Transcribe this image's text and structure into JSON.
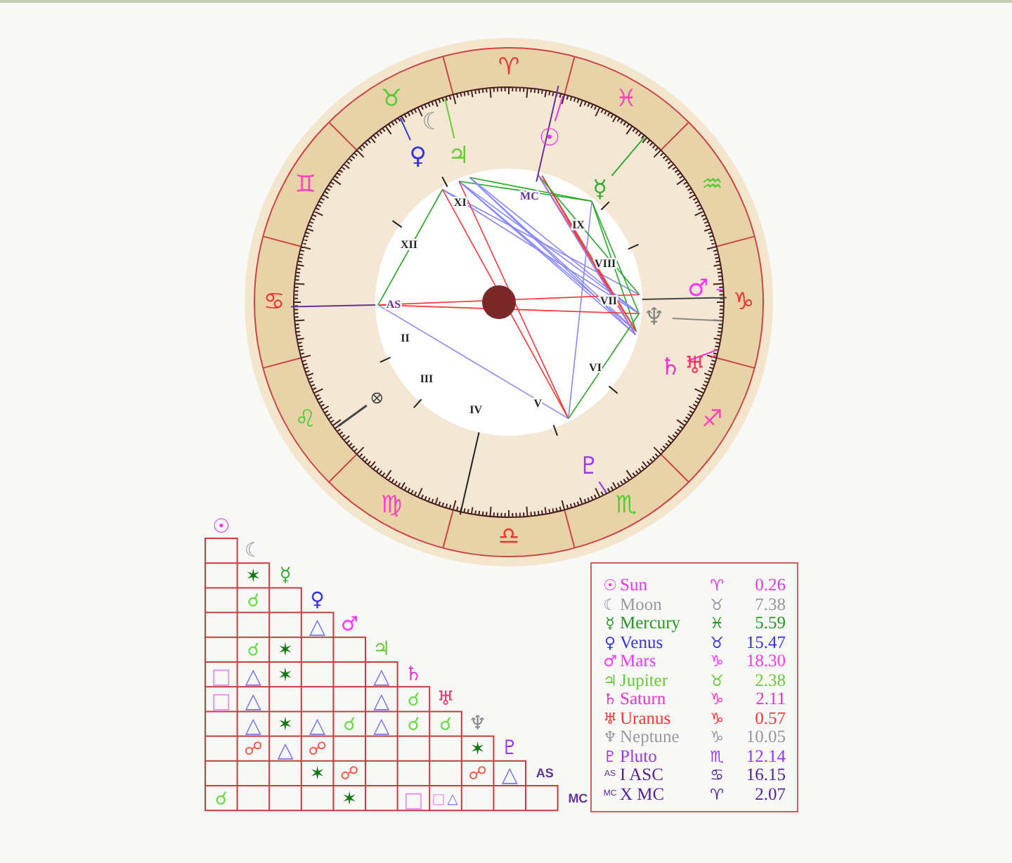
{
  "wheel": {
    "signs": [
      {
        "glyph": "♈︎",
        "color": "#ee3333"
      },
      {
        "glyph": "♉︎",
        "color": "#55cc33"
      },
      {
        "glyph": "♊︎",
        "color": "#ff44bb"
      },
      {
        "glyph": "♋︎",
        "color": "#ee3333"
      },
      {
        "glyph": "♌︎",
        "color": "#55cc33"
      },
      {
        "glyph": "♍︎",
        "color": "#ff44bb"
      },
      {
        "glyph": "♎︎",
        "color": "#ee3333"
      },
      {
        "glyph": "♏︎",
        "color": "#55cc33"
      },
      {
        "glyph": "♐︎",
        "color": "#ff44bb"
      },
      {
        "glyph": "♑︎",
        "color": "#ee3333"
      },
      {
        "glyph": "♒︎",
        "color": "#55cc33"
      },
      {
        "glyph": "♓︎",
        "color": "#ff44bb"
      }
    ],
    "planets": [
      {
        "glyph": "☉",
        "color": "#ee33ee"
      },
      {
        "glyph": "☾",
        "color": "#999999"
      },
      {
        "glyph": "☿",
        "color": "#33aa33"
      },
      {
        "glyph": "♀",
        "color": "#3333ee"
      },
      {
        "glyph": "♂",
        "color": "#ff33ff"
      },
      {
        "glyph": "♃",
        "color": "#66cc33"
      },
      {
        "glyph": "♄",
        "color": "#ee33cc"
      },
      {
        "glyph": "♅",
        "color": "#ff3366"
      },
      {
        "glyph": "♆",
        "color": "#888888"
      },
      {
        "glyph": "♇",
        "color": "#9933ff"
      }
    ],
    "houses": [
      {
        "label": "AS",
        "color": "#663399"
      },
      {
        "label": "II",
        "color": "#222222"
      },
      {
        "label": "III",
        "color": "#222222"
      },
      {
        "label": "IV",
        "color": "#222222"
      },
      {
        "label": "V",
        "color": "#222222"
      },
      {
        "label": "VI",
        "color": "#222222"
      },
      {
        "label": "VII",
        "color": "#222222"
      },
      {
        "label": "VIII",
        "color": "#222222"
      },
      {
        "label": "IX",
        "color": "#222222"
      },
      {
        "label": "MC",
        "color": "#663399"
      },
      {
        "label": "XI",
        "color": "#222222"
      },
      {
        "label": "XII",
        "color": "#222222"
      }
    ]
  },
  "aspect_grid": {
    "headers": [
      {
        "kind": "planet",
        "glyph": "☉",
        "color": "#ee33ee"
      },
      {
        "kind": "planet",
        "glyph": "☾",
        "color": "#999999"
      },
      {
        "kind": "planet",
        "glyph": "☿",
        "color": "#33aa33"
      },
      {
        "kind": "planet",
        "glyph": "♀",
        "color": "#3333ee"
      },
      {
        "kind": "planet",
        "glyph": "♂",
        "color": "#ff33ff"
      },
      {
        "kind": "planet",
        "glyph": "♃",
        "color": "#66cc33"
      },
      {
        "kind": "planet",
        "glyph": "♄",
        "color": "#ee33cc"
      },
      {
        "kind": "planet",
        "glyph": "♅",
        "color": "#ff3366"
      },
      {
        "kind": "planet",
        "glyph": "♆",
        "color": "#888888"
      },
      {
        "kind": "planet",
        "glyph": "♇",
        "color": "#9933ff"
      },
      {
        "kind": "angle",
        "glyph": "AS",
        "color": "#663399"
      },
      {
        "kind": "angle",
        "glyph": "MC",
        "color": "#663399"
      }
    ],
    "rows": [
      [
        null
      ],
      [
        null,
        [
          {
            "kind": "sextile",
            "symbol": "✶"
          }
        ]
      ],
      [
        null,
        [
          {
            "kind": "conjunction",
            "symbol": "☌"
          }
        ],
        null
      ],
      [
        null,
        null,
        null,
        [
          {
            "kind": "trine",
            "symbol": "△"
          }
        ]
      ],
      [
        null,
        [
          {
            "kind": "conjunction",
            "symbol": "☌"
          }
        ],
        [
          {
            "kind": "sextile",
            "symbol": "✶"
          }
        ],
        null,
        null
      ],
      [
        [
          {
            "kind": "square",
            "symbol": "□"
          }
        ],
        [
          {
            "kind": "trine",
            "symbol": "△"
          }
        ],
        [
          {
            "kind": "sextile",
            "symbol": "✶"
          }
        ],
        null,
        null,
        [
          {
            "kind": "trine",
            "symbol": "△"
          }
        ]
      ],
      [
        [
          {
            "kind": "square",
            "symbol": "□"
          }
        ],
        [
          {
            "kind": "trine",
            "symbol": "△"
          }
        ],
        null,
        null,
        null,
        [
          {
            "kind": "trine",
            "symbol": "△"
          }
        ],
        [
          {
            "kind": "conjunction",
            "symbol": "☌"
          }
        ]
      ],
      [
        null,
        [
          {
            "kind": "trine",
            "symbol": "△"
          }
        ],
        [
          {
            "kind": "sextile",
            "symbol": "✶"
          }
        ],
        [
          {
            "kind": "trine",
            "symbol": "△"
          }
        ],
        [
          {
            "kind": "conjunction",
            "symbol": "☌"
          }
        ],
        [
          {
            "kind": "trine",
            "symbol": "△"
          }
        ],
        [
          {
            "kind": "conjunction",
            "symbol": "☌"
          }
        ],
        [
          {
            "kind": "conjunction",
            "symbol": "☌"
          }
        ]
      ],
      [
        null,
        [
          {
            "kind": "opposition",
            "symbol": "☍"
          }
        ],
        [
          {
            "kind": "trine",
            "symbol": "△"
          }
        ],
        [
          {
            "kind": "opposition",
            "symbol": "☍"
          }
        ],
        null,
        null,
        null,
        null,
        [
          {
            "kind": "sextile",
            "symbol": "✶"
          }
        ]
      ],
      [
        null,
        null,
        null,
        [
          {
            "kind": "sextile",
            "symbol": "✶"
          }
        ],
        [
          {
            "kind": "opposition",
            "symbol": "☍"
          }
        ],
        null,
        null,
        null,
        [
          {
            "kind": "opposition",
            "symbol": "☍"
          }
        ],
        [
          {
            "kind": "trine",
            "symbol": "△"
          }
        ]
      ],
      [
        [
          {
            "kind": "conjunction",
            "symbol": "☌"
          }
        ],
        null,
        null,
        null,
        [
          {
            "kind": "sextile",
            "symbol": "✶"
          }
        ],
        null,
        [
          {
            "kind": "square",
            "symbol": "□"
          }
        ],
        [
          {
            "kind": "square",
            "symbol": "□"
          },
          {
            "kind": "trine",
            "symbol": "△"
          }
        ],
        null,
        null,
        null
      ]
    ]
  },
  "positions": [
    {
      "kind": "planet",
      "glyph": "☉",
      "name": "Sun",
      "sign": "♈︎",
      "degree": "0.26",
      "color": "#ee33ee"
    },
    {
      "kind": "planet",
      "glyph": "☾",
      "name": "Moon",
      "sign": "♉︎",
      "degree": "7.38",
      "color": "#999999"
    },
    {
      "kind": "planet",
      "glyph": "☿",
      "name": "Mercury",
      "sign": "♓︎",
      "degree": "5.59",
      "color": "#229922"
    },
    {
      "kind": "planet",
      "glyph": "♀",
      "name": "Venus",
      "sign": "♉︎",
      "degree": "15.47",
      "color": "#3333ee"
    },
    {
      "kind": "planet",
      "glyph": "♂",
      "name": "Mars",
      "sign": "♑︎",
      "degree": "18.30",
      "color": "#ff33ff"
    },
    {
      "kind": "planet",
      "glyph": "♃",
      "name": "Jupiter",
      "sign": "♉︎",
      "degree": "2.38",
      "color": "#66cc33"
    },
    {
      "kind": "planet",
      "glyph": "♄",
      "name": "Saturn",
      "sign": "♑︎",
      "degree": "2.11",
      "color": "#ee33cc"
    },
    {
      "kind": "planet",
      "glyph": "♅",
      "name": "Uranus",
      "sign": "♑︎",
      "degree": "0.57",
      "color": "#ff3333"
    },
    {
      "kind": "planet",
      "glyph": "♆",
      "name": "Neptune",
      "sign": "♑︎",
      "degree": "10.05",
      "color": "#999999"
    },
    {
      "kind": "planet",
      "glyph": "♇",
      "name": "Pluto",
      "sign": "♏︎",
      "degree": "12.14",
      "color": "#9933ff"
    },
    {
      "kind": "angle",
      "glyph": "AS",
      "name": "I ASC",
      "sign": "♋︎",
      "degree": "16.15",
      "color": "#551d99"
    },
    {
      "kind": "angle",
      "glyph": "MC",
      "name": "X MC",
      "sign": "♈︎",
      "degree": "2.07",
      "color": "#551d99"
    }
  ]
}
